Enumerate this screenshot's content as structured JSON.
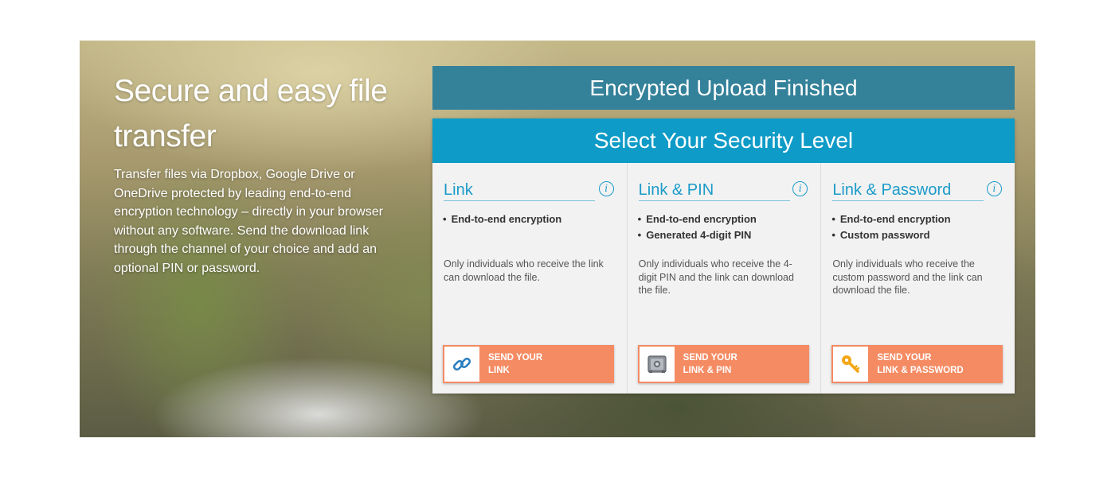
{
  "hero": {
    "title": "Secure and easy file transfer",
    "description": "Transfer files via Dropbox, Google Drive or OneDrive protected by leading end-to-end encryption technology – directly in your browser without any software. Send the download link through the channel of your choice and add an optional PIN or password."
  },
  "status": {
    "label": "Encrypted Upload Finished",
    "color": "#34819a"
  },
  "security": {
    "header": "Select Your Security Level",
    "header_color": "#0f9bc7",
    "button_color": "#f58b63",
    "options": [
      {
        "title": "Link",
        "info_icon": "info-icon",
        "features": [
          "End-to-end encryption"
        ],
        "description": "Only individuals who receive the link can download the file.",
        "button_icon": "link-chain-icon",
        "button_line1": "SEND YOUR",
        "button_line2": "LINK"
      },
      {
        "title": "Link & PIN",
        "info_icon": "info-icon",
        "features": [
          "End-to-end encryption",
          "Generated 4-digit PIN"
        ],
        "description": "Only individuals who receive the 4-digit PIN and the link can download the file.",
        "button_icon": "safe-icon",
        "button_line1": "SEND YOUR",
        "button_line2": "LINK & PIN"
      },
      {
        "title": "Link & Password",
        "info_icon": "info-icon",
        "features": [
          "End-to-end encryption",
          "Custom password"
        ],
        "description": "Only individuals who receive the custom password and the link can download the file.",
        "button_icon": "key-icon",
        "button_line1": "SEND YOUR",
        "button_line2": "LINK & PASSWORD"
      }
    ]
  }
}
